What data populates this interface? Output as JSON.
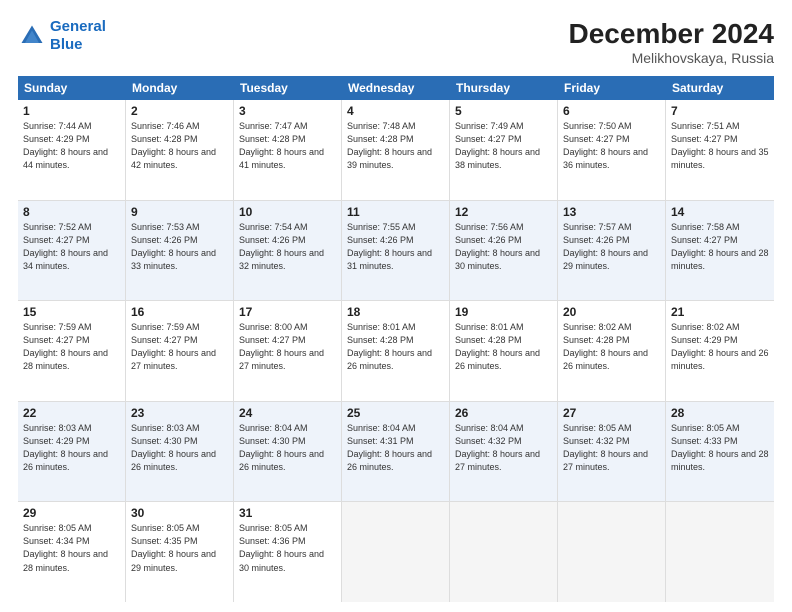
{
  "header": {
    "logo_line1": "General",
    "logo_line2": "Blue",
    "main_title": "December 2024",
    "subtitle": "Melikhovskaya, Russia"
  },
  "days_of_week": [
    "Sunday",
    "Monday",
    "Tuesday",
    "Wednesday",
    "Thursday",
    "Friday",
    "Saturday"
  ],
  "weeks": [
    [
      {
        "day": "1",
        "sunrise": "Sunrise: 7:44 AM",
        "sunset": "Sunset: 4:29 PM",
        "daylight": "Daylight: 8 hours and 44 minutes."
      },
      {
        "day": "2",
        "sunrise": "Sunrise: 7:46 AM",
        "sunset": "Sunset: 4:28 PM",
        "daylight": "Daylight: 8 hours and 42 minutes."
      },
      {
        "day": "3",
        "sunrise": "Sunrise: 7:47 AM",
        "sunset": "Sunset: 4:28 PM",
        "daylight": "Daylight: 8 hours and 41 minutes."
      },
      {
        "day": "4",
        "sunrise": "Sunrise: 7:48 AM",
        "sunset": "Sunset: 4:28 PM",
        "daylight": "Daylight: 8 hours and 39 minutes."
      },
      {
        "day": "5",
        "sunrise": "Sunrise: 7:49 AM",
        "sunset": "Sunset: 4:27 PM",
        "daylight": "Daylight: 8 hours and 38 minutes."
      },
      {
        "day": "6",
        "sunrise": "Sunrise: 7:50 AM",
        "sunset": "Sunset: 4:27 PM",
        "daylight": "Daylight: 8 hours and 36 minutes."
      },
      {
        "day": "7",
        "sunrise": "Sunrise: 7:51 AM",
        "sunset": "Sunset: 4:27 PM",
        "daylight": "Daylight: 8 hours and 35 minutes."
      }
    ],
    [
      {
        "day": "8",
        "sunrise": "Sunrise: 7:52 AM",
        "sunset": "Sunset: 4:27 PM",
        "daylight": "Daylight: 8 hours and 34 minutes."
      },
      {
        "day": "9",
        "sunrise": "Sunrise: 7:53 AM",
        "sunset": "Sunset: 4:26 PM",
        "daylight": "Daylight: 8 hours and 33 minutes."
      },
      {
        "day": "10",
        "sunrise": "Sunrise: 7:54 AM",
        "sunset": "Sunset: 4:26 PM",
        "daylight": "Daylight: 8 hours and 32 minutes."
      },
      {
        "day": "11",
        "sunrise": "Sunrise: 7:55 AM",
        "sunset": "Sunset: 4:26 PM",
        "daylight": "Daylight: 8 hours and 31 minutes."
      },
      {
        "day": "12",
        "sunrise": "Sunrise: 7:56 AM",
        "sunset": "Sunset: 4:26 PM",
        "daylight": "Daylight: 8 hours and 30 minutes."
      },
      {
        "day": "13",
        "sunrise": "Sunrise: 7:57 AM",
        "sunset": "Sunset: 4:26 PM",
        "daylight": "Daylight: 8 hours and 29 minutes."
      },
      {
        "day": "14",
        "sunrise": "Sunrise: 7:58 AM",
        "sunset": "Sunset: 4:27 PM",
        "daylight": "Daylight: 8 hours and 28 minutes."
      }
    ],
    [
      {
        "day": "15",
        "sunrise": "Sunrise: 7:59 AM",
        "sunset": "Sunset: 4:27 PM",
        "daylight": "Daylight: 8 hours and 28 minutes."
      },
      {
        "day": "16",
        "sunrise": "Sunrise: 7:59 AM",
        "sunset": "Sunset: 4:27 PM",
        "daylight": "Daylight: 8 hours and 27 minutes."
      },
      {
        "day": "17",
        "sunrise": "Sunrise: 8:00 AM",
        "sunset": "Sunset: 4:27 PM",
        "daylight": "Daylight: 8 hours and 27 minutes."
      },
      {
        "day": "18",
        "sunrise": "Sunrise: 8:01 AM",
        "sunset": "Sunset: 4:28 PM",
        "daylight": "Daylight: 8 hours and 26 minutes."
      },
      {
        "day": "19",
        "sunrise": "Sunrise: 8:01 AM",
        "sunset": "Sunset: 4:28 PM",
        "daylight": "Daylight: 8 hours and 26 minutes."
      },
      {
        "day": "20",
        "sunrise": "Sunrise: 8:02 AM",
        "sunset": "Sunset: 4:28 PM",
        "daylight": "Daylight: 8 hours and 26 minutes."
      },
      {
        "day": "21",
        "sunrise": "Sunrise: 8:02 AM",
        "sunset": "Sunset: 4:29 PM",
        "daylight": "Daylight: 8 hours and 26 minutes."
      }
    ],
    [
      {
        "day": "22",
        "sunrise": "Sunrise: 8:03 AM",
        "sunset": "Sunset: 4:29 PM",
        "daylight": "Daylight: 8 hours and 26 minutes."
      },
      {
        "day": "23",
        "sunrise": "Sunrise: 8:03 AM",
        "sunset": "Sunset: 4:30 PM",
        "daylight": "Daylight: 8 hours and 26 minutes."
      },
      {
        "day": "24",
        "sunrise": "Sunrise: 8:04 AM",
        "sunset": "Sunset: 4:30 PM",
        "daylight": "Daylight: 8 hours and 26 minutes."
      },
      {
        "day": "25",
        "sunrise": "Sunrise: 8:04 AM",
        "sunset": "Sunset: 4:31 PM",
        "daylight": "Daylight: 8 hours and 26 minutes."
      },
      {
        "day": "26",
        "sunrise": "Sunrise: 8:04 AM",
        "sunset": "Sunset: 4:32 PM",
        "daylight": "Daylight: 8 hours and 27 minutes."
      },
      {
        "day": "27",
        "sunrise": "Sunrise: 8:05 AM",
        "sunset": "Sunset: 4:32 PM",
        "daylight": "Daylight: 8 hours and 27 minutes."
      },
      {
        "day": "28",
        "sunrise": "Sunrise: 8:05 AM",
        "sunset": "Sunset: 4:33 PM",
        "daylight": "Daylight: 8 hours and 28 minutes."
      }
    ],
    [
      {
        "day": "29",
        "sunrise": "Sunrise: 8:05 AM",
        "sunset": "Sunset: 4:34 PM",
        "daylight": "Daylight: 8 hours and 28 minutes."
      },
      {
        "day": "30",
        "sunrise": "Sunrise: 8:05 AM",
        "sunset": "Sunset: 4:35 PM",
        "daylight": "Daylight: 8 hours and 29 minutes."
      },
      {
        "day": "31",
        "sunrise": "Sunrise: 8:05 AM",
        "sunset": "Sunset: 4:36 PM",
        "daylight": "Daylight: 8 hours and 30 minutes."
      },
      null,
      null,
      null,
      null
    ]
  ]
}
